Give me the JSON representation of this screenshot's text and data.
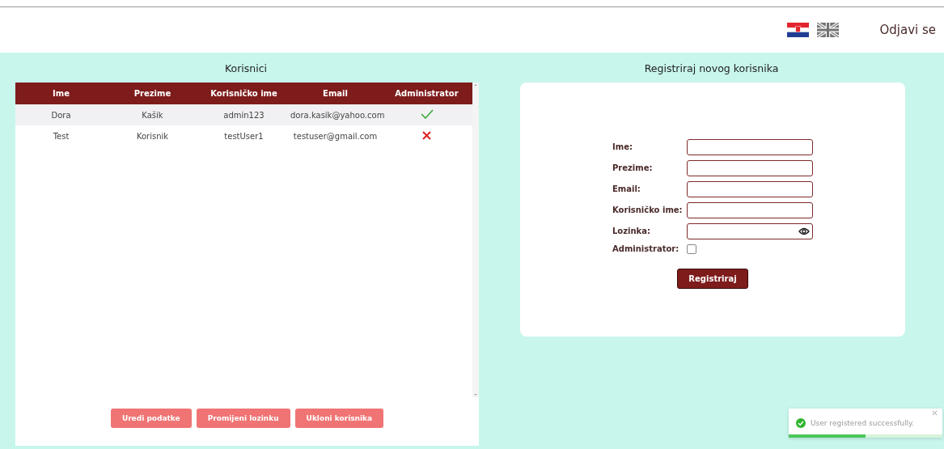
{
  "header": {
    "languages": [
      {
        "kind": "hr",
        "selected": true
      },
      {
        "kind": "uk",
        "selected": false
      }
    ],
    "logout": "Odjavi se"
  },
  "users": {
    "title": "Korisnici",
    "columns": [
      "Ime",
      "Prezime",
      "Korisničko ime",
      "Email",
      "Administrator"
    ],
    "rows": [
      {
        "cells": [
          "Dora",
          "Kašik",
          "admin123",
          "dora.kasik@yahoo.com"
        ],
        "admin": true,
        "selected": true
      },
      {
        "cells": [
          "Test",
          "Korisnik",
          "testUser1",
          "testuser@gmail.com"
        ],
        "admin": false,
        "selected": false
      }
    ],
    "buttons": [
      "Uredi podatke",
      "Promijeni lozinku",
      "Ukloni korisnika"
    ]
  },
  "register": {
    "title": "Registriraj novog korisnika",
    "fields": [
      {
        "label": "Ime:",
        "kind": "text"
      },
      {
        "label": "Prezime:",
        "kind": "text"
      },
      {
        "label": "Email:",
        "kind": "text"
      },
      {
        "label": "Korisničko ime:",
        "kind": "text"
      },
      {
        "label": "Lozinka:",
        "kind": "password"
      },
      {
        "label": "Administrator:",
        "kind": "checkbox",
        "checked": false
      }
    ],
    "submit": "Registriraj"
  },
  "toast": {
    "message": "User registered successfully.",
    "level": 0.5
  }
}
